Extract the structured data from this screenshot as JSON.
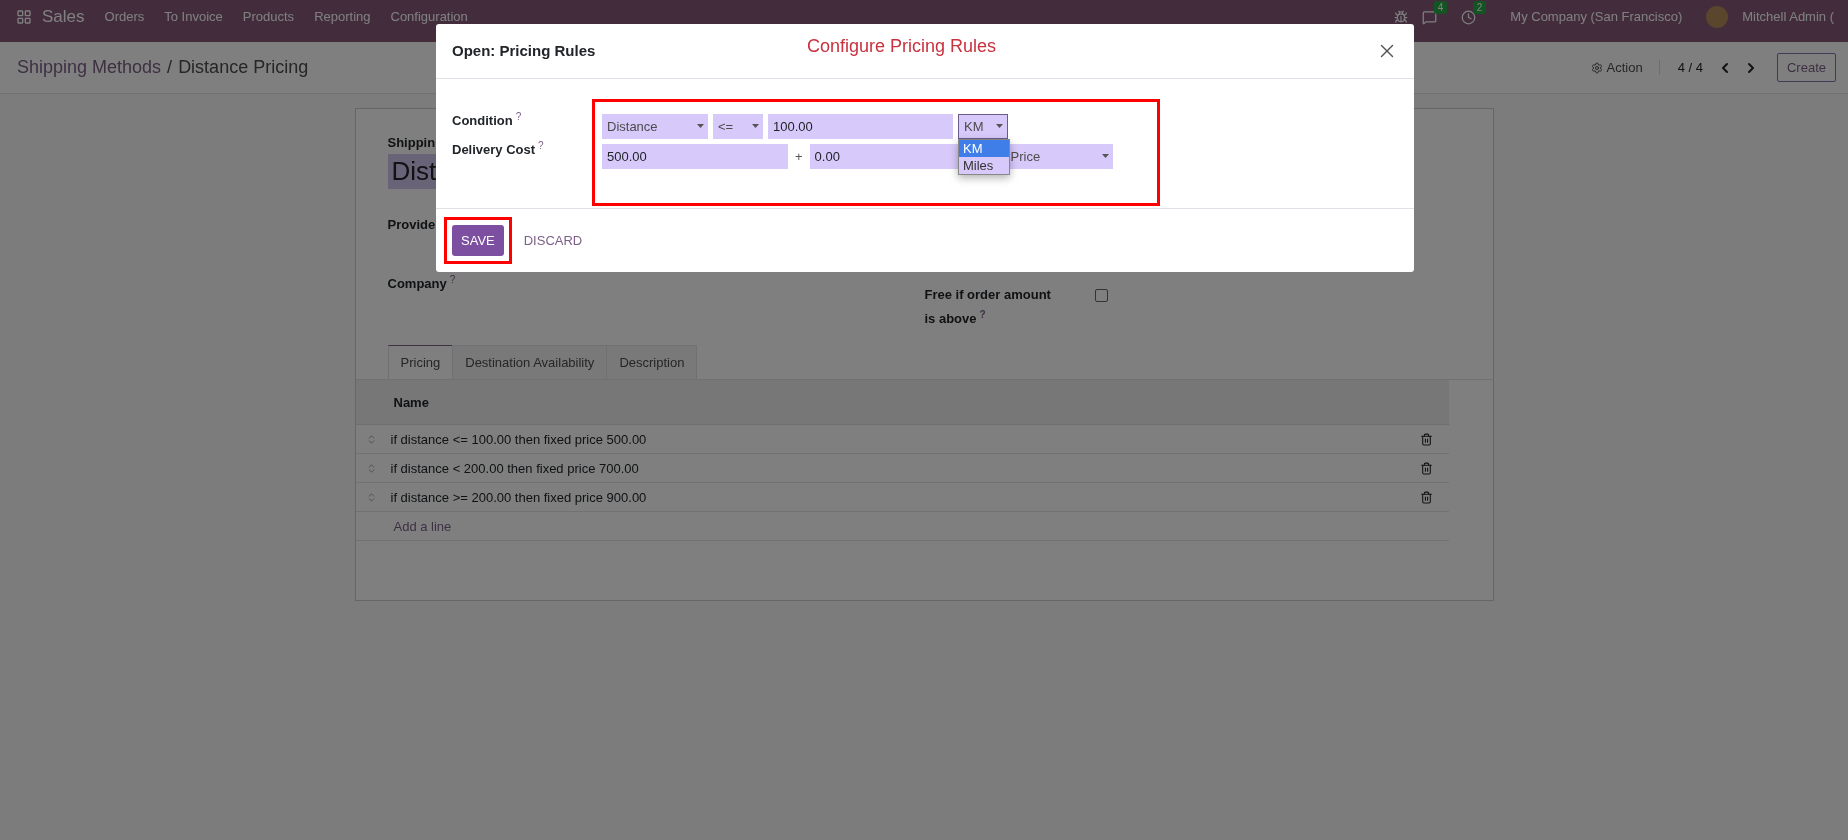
{
  "navbar": {
    "app": "Sales",
    "menu": [
      "Orders",
      "To Invoice",
      "Products",
      "Reporting",
      "Configuration"
    ],
    "messages_badge": "4",
    "activities_badge": "2",
    "company": "My Company (San Francisco)",
    "user": "Mitchell Admin ("
  },
  "breadcrumb": {
    "parent": "Shipping Methods",
    "separator": "/",
    "current": "Distance Pricing"
  },
  "control_panel": {
    "action": "Action",
    "pager": "4 / 4",
    "create": "Create"
  },
  "form": {
    "name_label": "Shippin",
    "name_value": "Dist",
    "provider_label": "Provide",
    "company_label": "Company",
    "company_help": "?",
    "free_label_lines": [
      "Free if order amount",
      "is above"
    ],
    "free_help": "?",
    "free_checked": false
  },
  "tabs": [
    {
      "label": "Pricing",
      "selected": true
    },
    {
      "label": "Destination Availability",
      "selected": false
    },
    {
      "label": "Description",
      "selected": false
    }
  ],
  "table": {
    "columns": [
      "Name"
    ],
    "rows": [
      "if distance <= 100.00 then fixed price 500.00",
      "if distance < 200.00 then fixed price 700.00",
      "if distance >= 200.00 then fixed price 900.00"
    ],
    "add_line": "Add a line"
  },
  "dialog": {
    "title": "Open: Pricing Rules",
    "annotation": "Configure Pricing Rules",
    "condition_label": "Condition",
    "condition_help": "?",
    "cost_label": "Delivery Cost",
    "cost_help": "?",
    "condition": {
      "variable": "Distance",
      "operator": "<=",
      "value": "100.00",
      "unit": "KM"
    },
    "unit_options": [
      {
        "label": "KM",
        "selected": true
      },
      {
        "label": "Miles",
        "selected": false
      }
    ],
    "cost": {
      "fixed": "500.00",
      "plus": "+",
      "variable": "0.00",
      "factor": "Price"
    },
    "save": "SAVE",
    "discard": "DISCARD"
  }
}
